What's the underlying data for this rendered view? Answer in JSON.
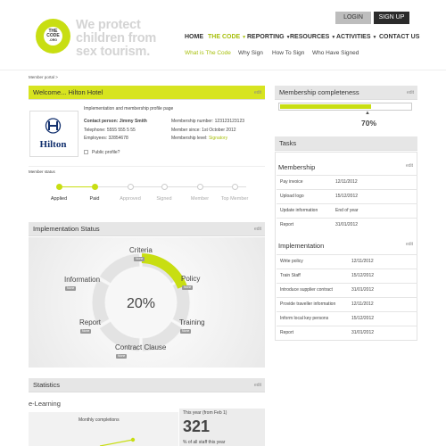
{
  "logo": {
    "line1": "THE",
    "line2": "CODE",
    "line3": ".ORG"
  },
  "tagline": "We protect children from sex tourism.",
  "auth": {
    "login": "LOGIN",
    "signup": "SIGN UP"
  },
  "nav": [
    {
      "label": "HOME",
      "caret": ""
    },
    {
      "label": "THE CODE",
      "caret": "▼"
    },
    {
      "label": "REPORTING",
      "caret": "▼"
    },
    {
      "label": "RESOURCES",
      "caret": "▼"
    },
    {
      "label": "ACTIVITIES",
      "caret": "▼"
    },
    {
      "label": "CONTACT US",
      "caret": ""
    }
  ],
  "subnav": [
    "What is The Code",
    "Why Sign",
    "How To Sign",
    "Who Have Signed"
  ],
  "breadcrumb": "Member portal >",
  "welcome": {
    "title": "Welcome... Hilton Hotel",
    "edit": "edit",
    "subtitle": "Implementation and membership profile page",
    "logo_text": "Hilton",
    "contact_label": "Contact person: Jimmy Smith",
    "telephone": "Telephone: 5555 555 5 55",
    "employees": "Employees: 32854678",
    "membership_number": "Membership number: 123123123123",
    "member_since": "Member since: 1st October 2012",
    "member_level_label": "Membership level:",
    "member_level_value": "Signatory",
    "public_profile": "Public profile?"
  },
  "member_status": {
    "label": "Member status",
    "steps": [
      "Applied",
      "Paid",
      "Approved",
      "Signed",
      "Member",
      "Top Member"
    ],
    "completed": 2
  },
  "implementation": {
    "title": "Implementation Status",
    "edit": "edit",
    "center": "20%",
    "progress": 0.2,
    "segments": [
      {
        "label": "Criteria",
        "tag": "None"
      },
      {
        "label": "Policy",
        "tag": "None"
      },
      {
        "label": "Training",
        "tag": "None"
      },
      {
        "label": "Contract Clause",
        "tag": "None"
      },
      {
        "label": "Report",
        "tag": "None"
      },
      {
        "label": "Information",
        "tag": "None"
      }
    ]
  },
  "statistics": {
    "title": "Statistics",
    "edit": "edit",
    "elearning": "e-Learning",
    "monthly": "Monthly completions",
    "year_label": "This year (from Feb 1)",
    "year_value": "321",
    "pct_label": "% of all staff this year"
  },
  "membership_completeness": {
    "title": "Membership completeness",
    "edit": "edit",
    "value": "70%",
    "progress": 0.7,
    "pointer": "▲"
  },
  "tasks": {
    "title": "Tasks",
    "membership": {
      "title": "Membership",
      "edit": "edit",
      "rows": [
        {
          "task": "Pay invoice",
          "date": "12/11/2012"
        },
        {
          "task": "Upload logo",
          "date": "15/12/2012"
        },
        {
          "task": "Update information",
          "date": "End of year"
        },
        {
          "task": "Report",
          "date": "31/01/2012"
        }
      ]
    },
    "implementation": {
      "title": "Implementation",
      "edit": "edit",
      "rows": [
        {
          "task": "Write policy",
          "date": "12/11/2012"
        },
        {
          "task": "Train Staff",
          "date": "15/12/2012"
        },
        {
          "task": "Introduce supplier contract",
          "date": "31/01/2012"
        },
        {
          "task": "Provide traveller information",
          "date": "12/11/2012"
        },
        {
          "task": "Inform local key persons",
          "date": "15/12/2012"
        },
        {
          "task": "Report",
          "date": "31/01/2012"
        }
      ]
    }
  },
  "colors": {
    "accent": "#c8de12",
    "dark": "#2b2b2b",
    "panel": "#e6e6e6"
  }
}
